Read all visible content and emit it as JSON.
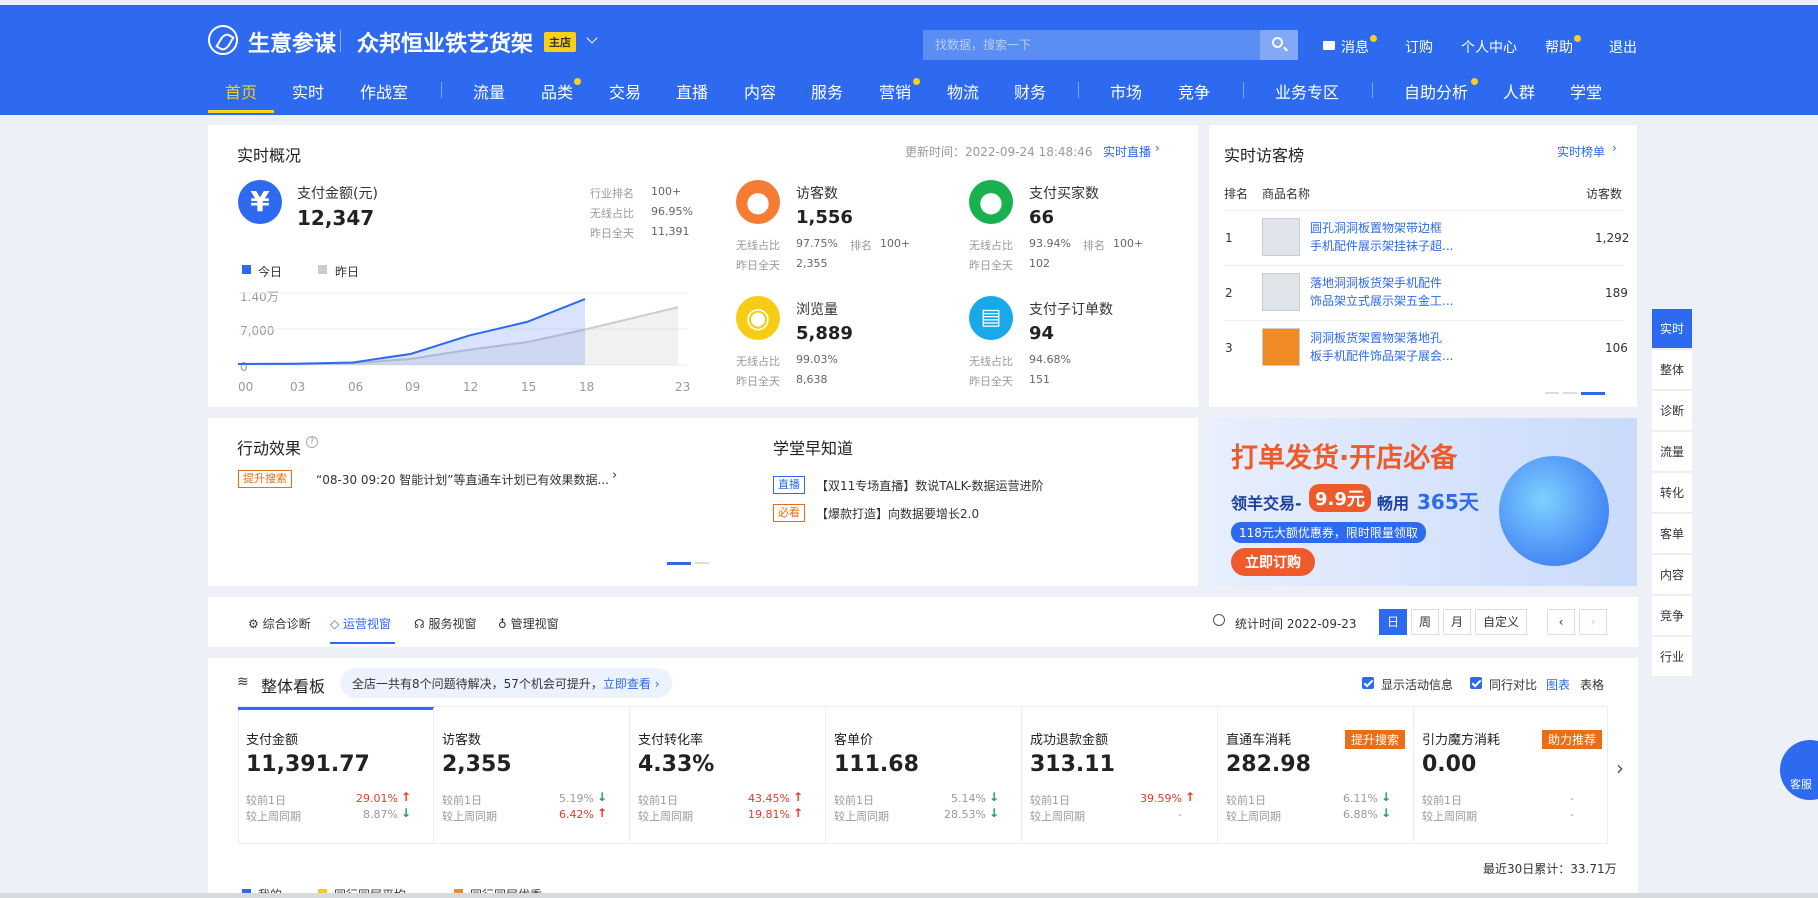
{
  "header": {
    "brand": "生意参谋",
    "shop_name": "众邦恒业铁艺货架",
    "shop_tag": "主店",
    "search_placeholder": "找数据，搜索一下",
    "links": [
      "消息",
      "订购",
      "个人中心",
      "帮助",
      "退出"
    ]
  },
  "nav": {
    "items": [
      "首页",
      "实时",
      "作战室",
      "流量",
      "品类",
      "交易",
      "直播",
      "内容",
      "服务",
      "营销",
      "物流",
      "财务",
      "市场",
      "竞争",
      "业务专区",
      "自助分析",
      "人群",
      "学堂"
    ],
    "active": "首页"
  },
  "realtime": {
    "title": "实时概况",
    "update_time": "更新时间：2022-09-24 18:48:46",
    "live_link": "实时直播",
    "pay": {
      "label": "支付金额(元)",
      "value": "12,347",
      "industry_rank_label": "行业排名",
      "industry_rank": "100+",
      "wireless_label": "无线占比",
      "wireless": "96.95%",
      "yesterday_label": "昨日全天",
      "yesterday": "11,391"
    },
    "legend": {
      "today": "今日",
      "yesterday": "昨日"
    },
    "yaxis": [
      "1.40万",
      "7,000",
      "0"
    ],
    "xaxis": [
      "00",
      "03",
      "06",
      "09",
      "12",
      "15",
      "18",
      "23"
    ],
    "metrics": [
      {
        "label": "访客数",
        "value": "1,556",
        "wireless_label": "无线占比",
        "wireless": "97.75%",
        "rank_label": "排名",
        "rank": "100+",
        "yesterday_label": "昨日全天",
        "yesterday": "2,355"
      },
      {
        "label": "支付买家数",
        "value": "66",
        "wireless_label": "无线占比",
        "wireless": "93.94%",
        "rank_label": "排名",
        "rank": "100+",
        "yesterday_label": "昨日全天",
        "yesterday": "102"
      },
      {
        "label": "浏览量",
        "value": "5,889",
        "wireless_label": "无线占比",
        "wireless": "99.03%",
        "yesterday_label": "昨日全天",
        "yesterday": "8,638"
      },
      {
        "label": "支付子订单数",
        "value": "94",
        "wireless_label": "无线占比",
        "wireless": "94.68%",
        "yesterday_label": "昨日全天",
        "yesterday": "151"
      }
    ]
  },
  "chart_data": {
    "type": "line",
    "x": [
      "00",
      "03",
      "06",
      "09",
      "12",
      "15",
      "18",
      "23"
    ],
    "ylim": [
      0,
      14000
    ],
    "series": [
      {
        "name": "今日",
        "values": [
          200,
          250,
          500,
          2200,
          5800,
          8500,
          13000
        ]
      },
      {
        "name": "昨日",
        "values": [
          150,
          200,
          350,
          1200,
          3000,
          4500,
          7000,
          11391
        ]
      }
    ]
  },
  "visitors": {
    "title": "实时访客榜",
    "link": "实时榜单",
    "col_rank": "排名",
    "col_name": "商品名称",
    "col_visitors": "访客数",
    "rows": [
      {
        "rank": "1",
        "name1": "圆孔洞洞板置物架带边框",
        "name2": "手机配件展示架挂袜子超...",
        "visitors": "1,292"
      },
      {
        "rank": "2",
        "name1": "落地洞洞板货架手机配件",
        "name2": "饰品架立式展示架五金工...",
        "visitors": "189"
      },
      {
        "rank": "3",
        "name1": "洞洞板货架置物架落地孔",
        "name2": "板手机配件饰品架子展会...",
        "visitors": "106"
      }
    ]
  },
  "action": {
    "title": "行动效果",
    "tag": "提升搜索",
    "text": "“08-30 09:20 智能计划”等直通车计划已有效果数据..."
  },
  "school": {
    "title": "学堂早知道",
    "items": [
      {
        "tag": "直播",
        "text": "【双11专场直播】数说TALK-数据运营进阶"
      },
      {
        "tag": "必看",
        "text": "【爆款打造】向数据要增长2.0"
      }
    ]
  },
  "banner": {
    "headline": "打单发货·开店必备",
    "line1_a": "领羊交易-",
    "price": "9.9元",
    "line1_b": "畅用",
    "days": "365天",
    "sub": "118元大额优惠券，限时限量领取",
    "cta": "立即订购"
  },
  "side_nav": [
    "实时",
    "整体",
    "诊断",
    "流量",
    "转化",
    "客单",
    "内容",
    "竞争",
    "行业"
  ],
  "tabs": {
    "items": [
      "综合诊断",
      "运营视窗",
      "服务视窗",
      "管理视窗"
    ],
    "active": "运营视窗",
    "stat_time": "统计时间 2022-09-23",
    "dates": [
      "日",
      "周",
      "月"
    ],
    "custom": "自定义"
  },
  "board": {
    "title": "整体看板",
    "notice_a": "全店一共有8个问题待解决，57个机会可提升，",
    "notice_link": "立即查看",
    "opt1": "显示活动信息",
    "opt2": "同行对比",
    "view_chart": "图表",
    "view_table": "表格",
    "footer": "最近30日累计：33.71万",
    "legend_bottom": [
      "我的",
      "同行同层平均",
      "同行同层优秀"
    ],
    "kpis": [
      {
        "label": "支付金额",
        "value": "11,391.77",
        "d1": "29.01%",
        "d1dir": "up",
        "w1": "8.87%",
        "w1dir": "down"
      },
      {
        "label": "访客数",
        "value": "2,355",
        "d1": "5.19%",
        "d1dir": "down",
        "w1": "6.42%",
        "w1dir": "up"
      },
      {
        "label": "支付转化率",
        "value": "4.33%",
        "d1": "43.45%",
        "d1dir": "up",
        "w1": "19.81%",
        "w1dir": "up"
      },
      {
        "label": "客单价",
        "value": "111.68",
        "d1": "5.14%",
        "d1dir": "down",
        "w1": "28.53%",
        "w1dir": "down"
      },
      {
        "label": "成功退款金额",
        "value": "313.11",
        "d1": "39.59%",
        "d1dir": "up",
        "w1": "-",
        "w1dir": ""
      },
      {
        "label": "直通车消耗",
        "value": "282.98",
        "d1": "6.11%",
        "d1dir": "down",
        "w1": "6.88%",
        "w1dir": "down",
        "badge": "提升搜索"
      },
      {
        "label": "引力魔方消耗",
        "value": "0.00",
        "d1": "-",
        "d1dir": "",
        "w1": "-",
        "w1dir": "",
        "badge": "助力推荐"
      }
    ],
    "cmp_day": "较前1日",
    "cmp_week": "较上周同期"
  },
  "service": "客服"
}
